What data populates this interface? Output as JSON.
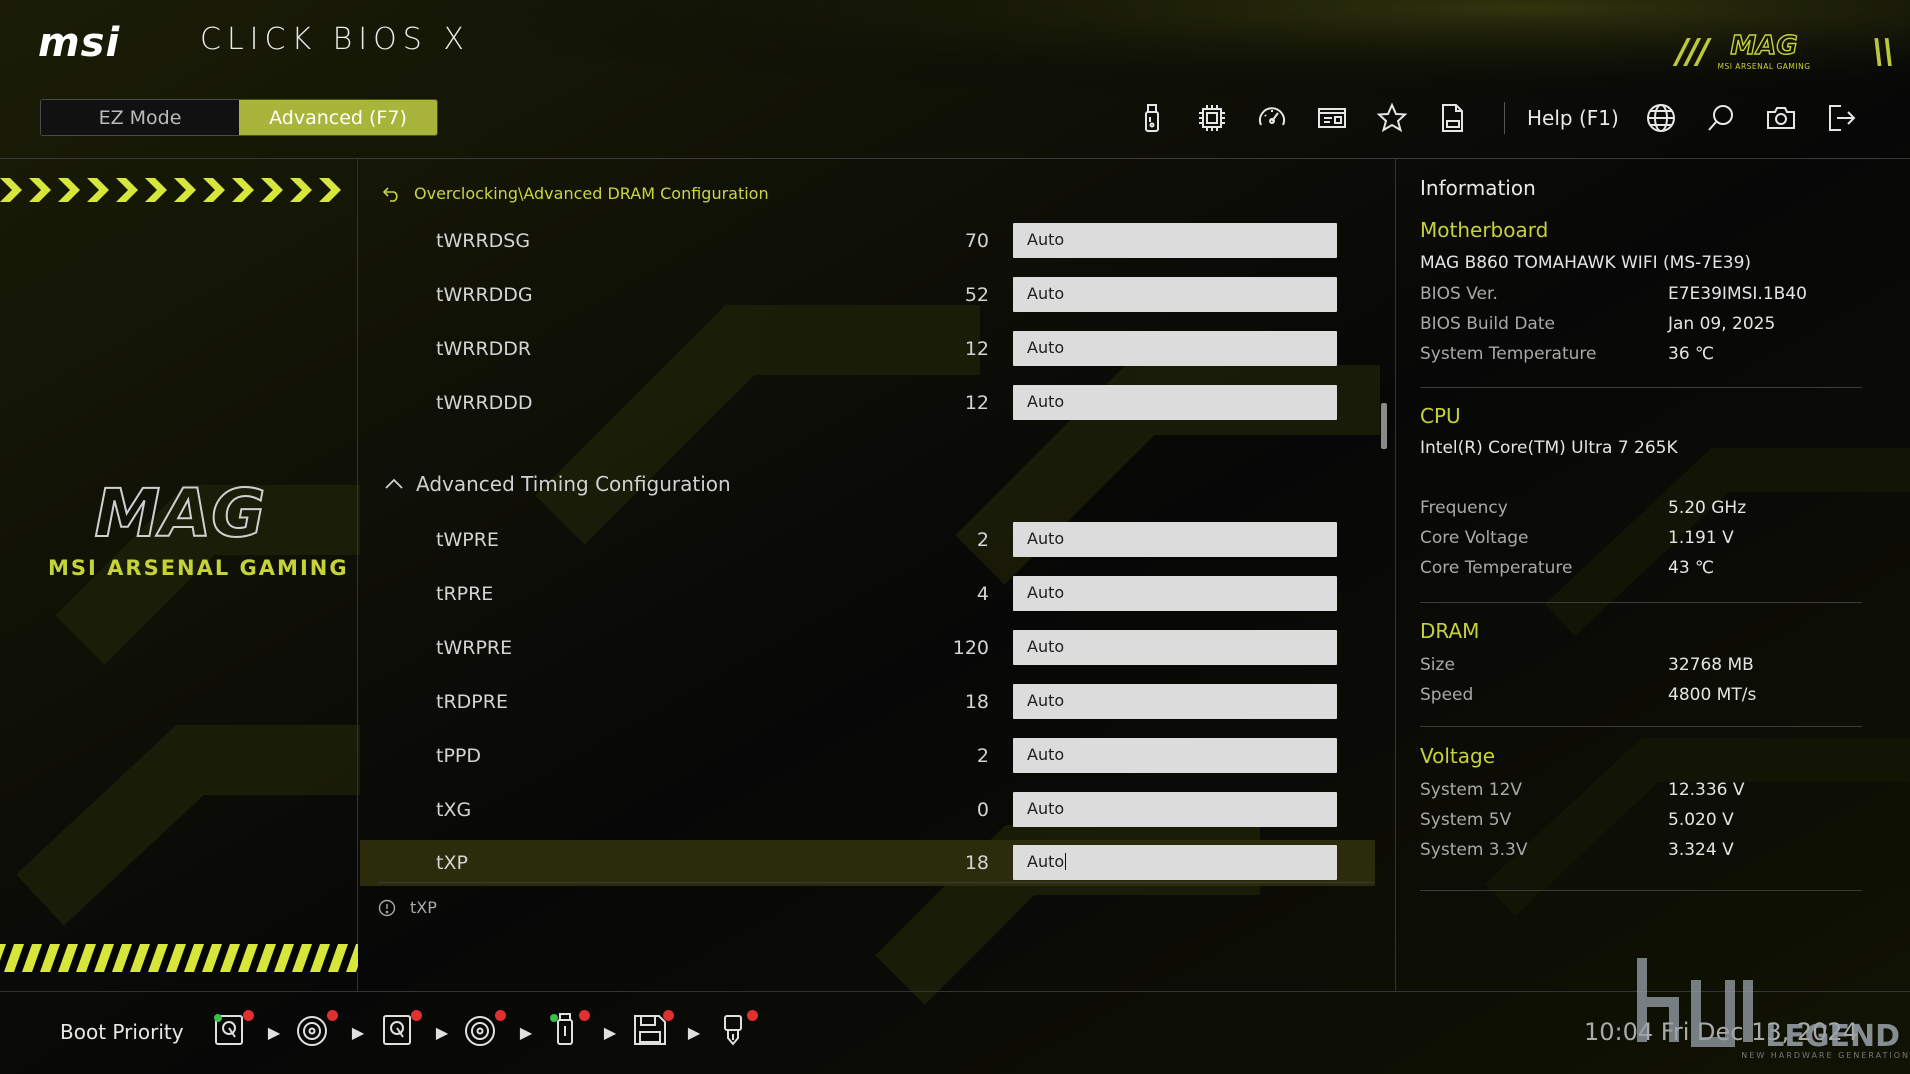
{
  "header": {
    "brand": "msi",
    "product": "CLICK BIOS X",
    "corner_badge": "MAG",
    "corner_badge_sub": "MSI ARSENAL GAMING",
    "mode_ez": "EZ Mode",
    "mode_advanced": "Advanced (F7)",
    "help": "Help (F1)",
    "accent_color": "#a8b53a"
  },
  "toolbar": {
    "icons": [
      "usb-drive-icon",
      "cpu-chip-icon",
      "gauge-icon",
      "hardware-monitor-icon",
      "favorites-star-icon",
      "bios-log-icon",
      "language-globe-icon",
      "search-icon",
      "screenshot-camera-icon",
      "exit-icon"
    ]
  },
  "brand_panel": {
    "logo": "MAG",
    "tagline": "MSI ARSENAL GAMING"
  },
  "main": {
    "breadcrumb": "Overclocking\\Advanced DRAM Configuration",
    "rows_top": [
      {
        "name": "tWRRDSG",
        "value": "70",
        "setting": "Auto"
      },
      {
        "name": "tWRRDDG",
        "value": "52",
        "setting": "Auto"
      },
      {
        "name": "tWRRDDR",
        "value": "12",
        "setting": "Auto"
      },
      {
        "name": "tWRRDDD",
        "value": "12",
        "setting": "Auto"
      }
    ],
    "section_title": "Advanced Timing Configuration",
    "rows_section": [
      {
        "name": "tWPRE",
        "value": "2",
        "setting": "Auto"
      },
      {
        "name": "tRPRE",
        "value": "4",
        "setting": "Auto"
      },
      {
        "name": "tWRPRE",
        "value": "120",
        "setting": "Auto"
      },
      {
        "name": "tRDPRE",
        "value": "18",
        "setting": "Auto"
      },
      {
        "name": "tPPD",
        "value": "2",
        "setting": "Auto"
      },
      {
        "name": "tXG",
        "value": "0",
        "setting": "Auto"
      },
      {
        "name": "tXP",
        "value": "18",
        "setting": "Auto"
      }
    ],
    "selected_row": "tXP",
    "hint": "tXP"
  },
  "info": {
    "title": "Information",
    "motherboard": {
      "heading": "Motherboard",
      "model": "MAG B860 TOMAHAWK WIFI (MS-7E39)",
      "bios_ver_label": "BIOS Ver.",
      "bios_ver": "E7E39IMSI.1B40",
      "build_date_label": "BIOS Build Date",
      "build_date": "Jan 09, 2025",
      "sys_temp_label": "System Temperature",
      "sys_temp": "36 ℃"
    },
    "cpu": {
      "heading": "CPU",
      "model": "Intel(R) Core(TM) Ultra 7 265K",
      "freq_label": "Frequency",
      "freq": "5.20 GHz",
      "volt_label": "Core Voltage",
      "volt": "1.191 V",
      "temp_label": "Core Temperature",
      "temp": "43 ℃"
    },
    "dram": {
      "heading": "DRAM",
      "size_label": "Size",
      "size": "32768 MB",
      "speed_label": "Speed",
      "speed": "4800 MT/s"
    },
    "voltage": {
      "heading": "Voltage",
      "v12_label": "System 12V",
      "v12": "12.336 V",
      "v5_label": "System 5V",
      "v5": "5.020 V",
      "v33_label": "System 3.3V",
      "v33": "3.324 V"
    }
  },
  "footer": {
    "boot_label": "Boot Priority",
    "boot_devices": [
      "hdd-icon",
      "optical-disc-icon",
      "hdd-icon",
      "optical-disc-icon",
      "usb-drive-icon",
      "floppy-icon",
      "usb-key-icon"
    ],
    "clock": "10:04  Fri Dec 13, 2024"
  },
  "watermark": {
    "text": "LEGEND",
    "sub": "NEW HARDWARE GENERATION"
  }
}
